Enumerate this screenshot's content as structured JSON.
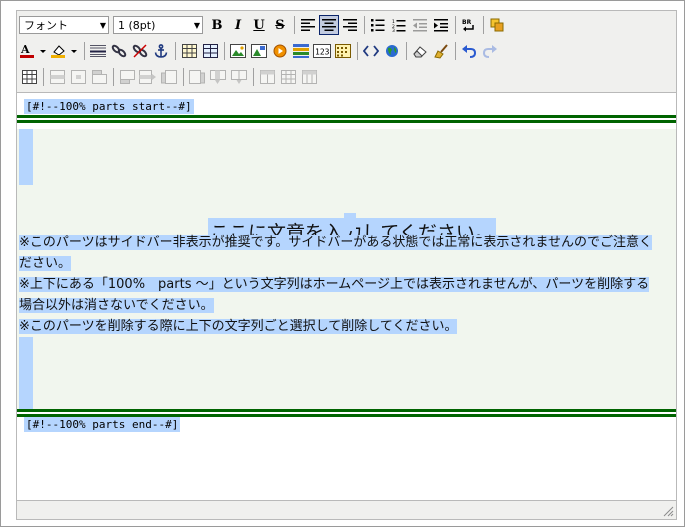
{
  "toolbar": {
    "font_select": {
      "value": "フォント"
    },
    "size_select": {
      "value": "1 (8pt)"
    },
    "bold_label": "B",
    "italic_label": "I",
    "underline_label": "U",
    "strike_label": "S"
  },
  "content": {
    "start_marker": "[#!--100%  parts  start--#]",
    "end_marker": "[#!--100%  parts  end--#]",
    "title": "ここに文章を入力してください。",
    "note1_line1": "※このパーツはサイドバー非表示が推奨です。サイドバーがある状態では正常に表示されませんのでご注意く",
    "note1_line2": "ださい。",
    "note2_line1": "※上下にある「100%　parts ～」という文字列はホームページ上では表示されませんが、パーツを削除する",
    "note2_line2": "場合以外は消さないでください。",
    "note3": "※このパーツを削除する際に上下の文字列ごと選択して削除してください。"
  },
  "colors": {
    "selection": "#b5d5fe",
    "divider_green": "#006400",
    "panel_green": "#f1f6ee",
    "toolbar_bg": "#f0f0ee"
  }
}
